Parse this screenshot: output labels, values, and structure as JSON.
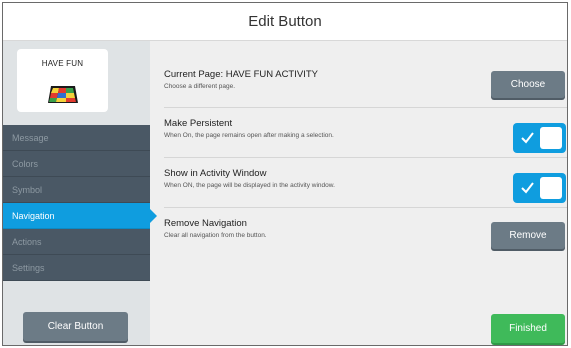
{
  "dialog": {
    "title": "Edit Button"
  },
  "preview": {
    "label": "HAVE FUN",
    "symbol_icon": "colorful-mat-icon"
  },
  "sidebar": {
    "items": [
      {
        "label": "Message",
        "active": false
      },
      {
        "label": "Colors",
        "active": false
      },
      {
        "label": "Symbol",
        "active": false
      },
      {
        "label": "Navigation",
        "active": true
      },
      {
        "label": "Actions",
        "active": false
      },
      {
        "label": "Settings",
        "active": false
      }
    ],
    "clear_label": "Clear Button"
  },
  "settings": {
    "current_page": {
      "title": "Current Page: HAVE FUN ACTIVITY",
      "desc": "Choose a different page.",
      "button": "Choose"
    },
    "persistent": {
      "title": "Make Persistent",
      "desc": "When On, the page remains open after making a selection.",
      "on": true
    },
    "activity_window": {
      "title": "Show in Activity Window",
      "desc": "When ON, the page will be displayed in the activity window.",
      "on": true
    },
    "remove_nav": {
      "title": "Remove Navigation",
      "desc": "Clear all navigation from the button.",
      "button": "Remove"
    }
  },
  "footer": {
    "finished_label": "Finished"
  },
  "colors": {
    "accent": "#0f9ddf",
    "sidebar_dark": "#4a5865",
    "button_gray": "#6c7b86",
    "finished_green": "#3fba5a"
  }
}
